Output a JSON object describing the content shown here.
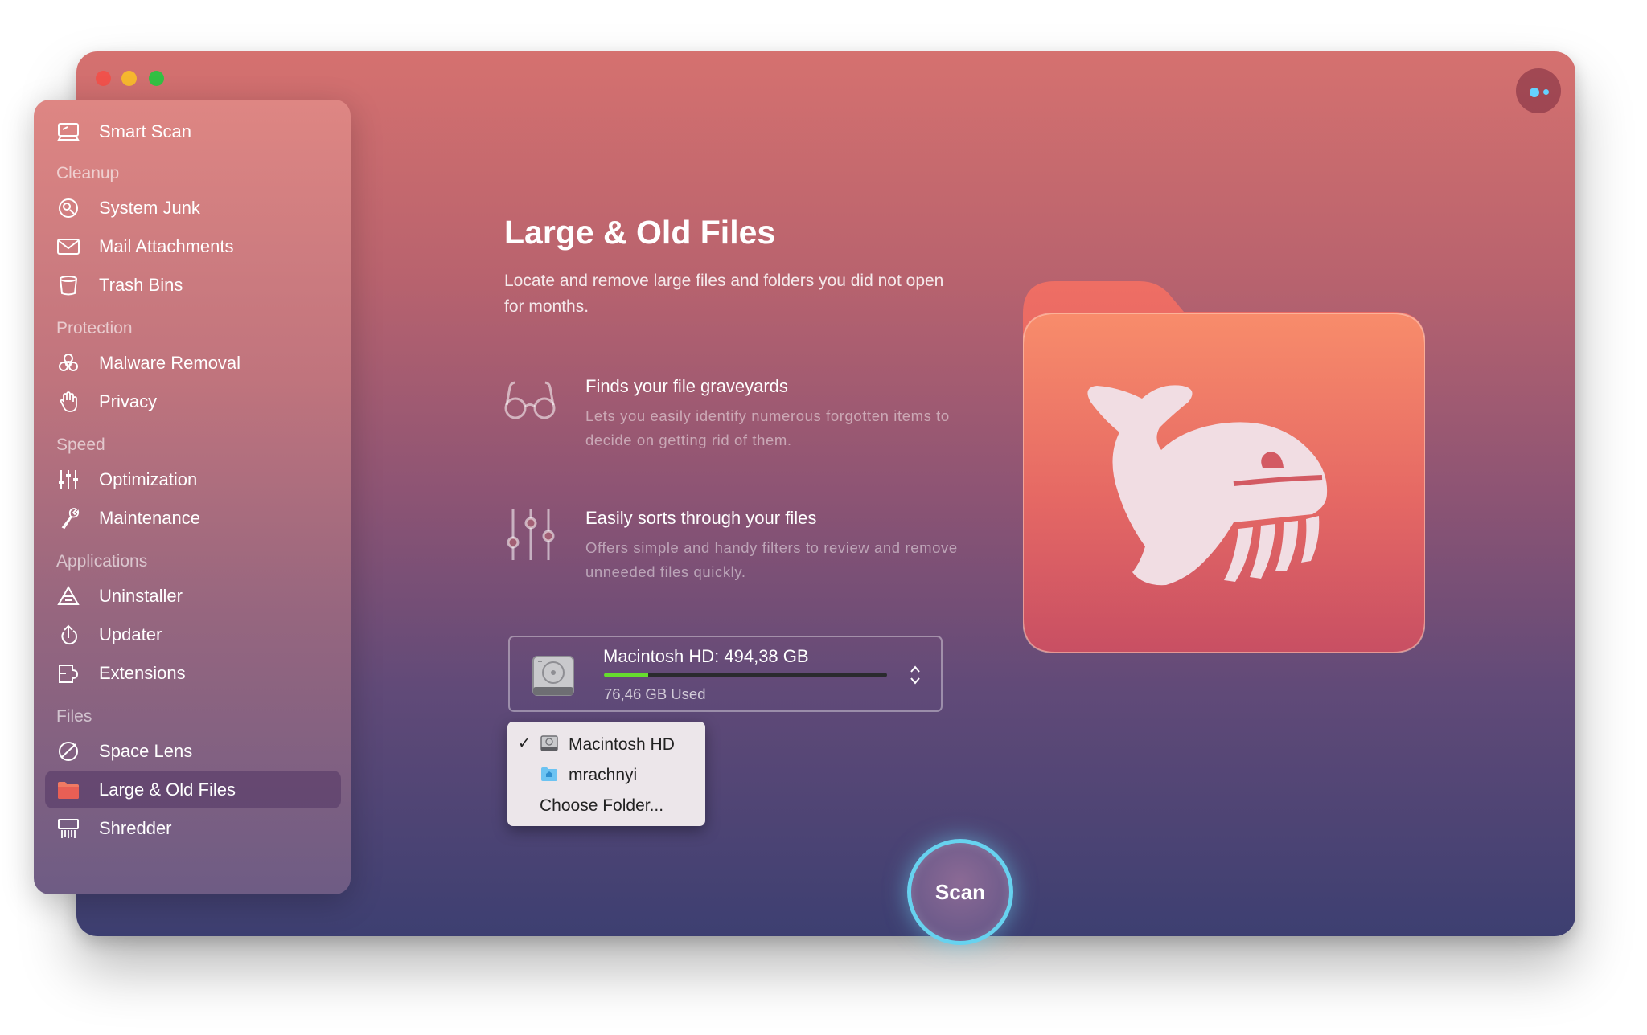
{
  "sidebar": {
    "smart_scan": "Smart Scan",
    "sections": {
      "cleanup": "Cleanup",
      "protection": "Protection",
      "speed": "Speed",
      "applications": "Applications",
      "files": "Files"
    },
    "items": {
      "system_junk": "System Junk",
      "mail_attachments": "Mail Attachments",
      "trash_bins": "Trash Bins",
      "malware_removal": "Malware Removal",
      "privacy": "Privacy",
      "optimization": "Optimization",
      "maintenance": "Maintenance",
      "uninstaller": "Uninstaller",
      "updater": "Updater",
      "extensions": "Extensions",
      "space_lens": "Space Lens",
      "large_old_files": "Large & Old Files",
      "shredder": "Shredder"
    },
    "active_item": "large_old_files"
  },
  "main": {
    "title": "Large & Old Files",
    "subtitle": "Locate and remove large files and folders you did not open for months.",
    "features": [
      {
        "icon": "glasses-icon",
        "title": "Finds your file graveyards",
        "description": "Lets you easily identify numerous forgotten items to decide on getting rid of them."
      },
      {
        "icon": "sliders-icon",
        "title": "Easily sorts through your files",
        "description": "Offers simple and handy filters to review and remove unneeded files quickly."
      }
    ]
  },
  "disk": {
    "name": "Macintosh HD: 494,38 GB",
    "used": "76,46 GB Used",
    "used_fraction": 0.155
  },
  "location_menu": {
    "items": [
      {
        "label": "Macintosh HD",
        "checked": true,
        "icon": "hard-drive-icon"
      },
      {
        "label": "mrachnyi",
        "checked": false,
        "icon": "home-folder-icon"
      },
      {
        "label": "Choose Folder...",
        "checked": false,
        "icon": ""
      }
    ]
  },
  "scan_button": "Scan",
  "colors": {
    "accent_ring": "#67d2ef",
    "disk_fill": "#66dd2e",
    "folder_orange": "#f5896b",
    "window_top": "#d5716f",
    "window_bottom": "#3d3f71"
  }
}
